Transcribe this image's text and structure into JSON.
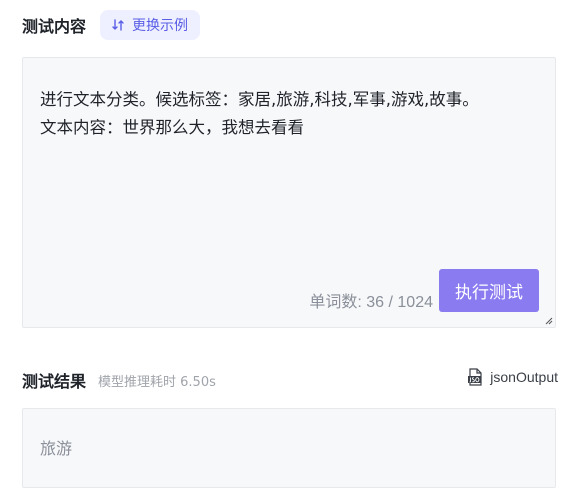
{
  "test_section": {
    "title": "测试内容",
    "swap_example_label": "更换示例"
  },
  "input": {
    "text": "进行文本分类。候选标签：家居,旅游,科技,军事,游戏,故事。\n文本内容：世界那么大，我想去看看",
    "counter": "单词数: 36 / 1024",
    "run_button_label": "执行测试"
  },
  "result_section": {
    "title": "测试结果",
    "time_info": "模型推理耗时 6.50s",
    "json_output_label": "jsonOutput"
  },
  "output": {
    "text": "旅游"
  },
  "colors": {
    "accent": "#8a7bf0",
    "swap_bg": "#eef0ff",
    "swap_fg": "#5a5ee6",
    "box_bg": "#f7f8fa"
  }
}
